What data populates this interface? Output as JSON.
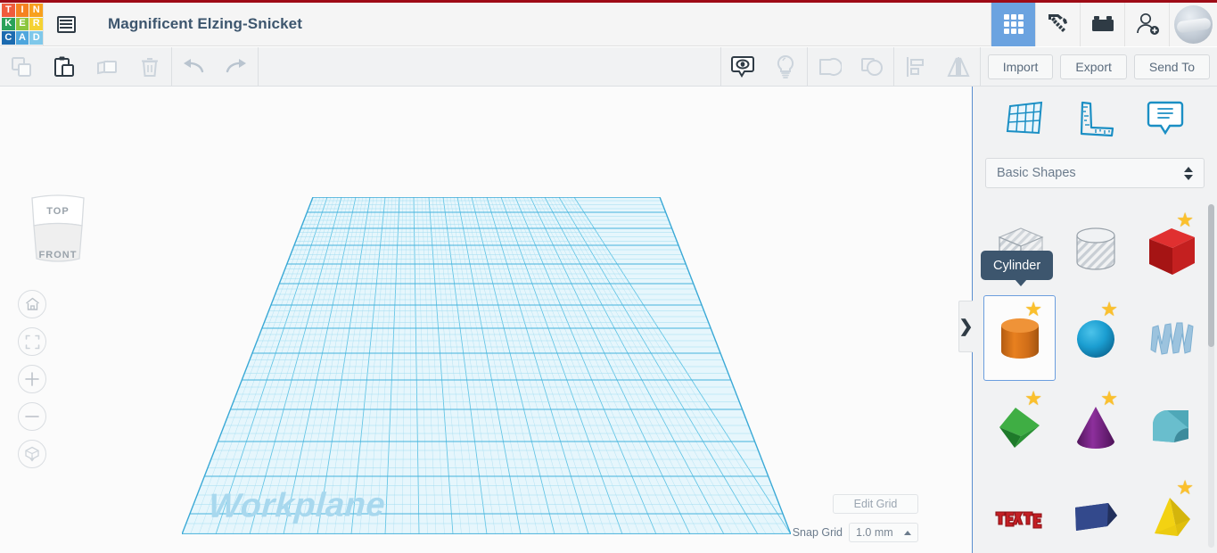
{
  "app": {
    "name": "Tinkercad",
    "accent_red": "#9e0b16",
    "accent_blue": "#1b8fc4",
    "selected_blue": "#6b9ede"
  },
  "logo": {
    "tiles": [
      {
        "letter": "T",
        "color": "#ef5b3c"
      },
      {
        "letter": "I",
        "color": "#f58220"
      },
      {
        "letter": "N",
        "color": "#f8a01c"
      },
      {
        "letter": "K",
        "color": "#2aa15a"
      },
      {
        "letter": "E",
        "color": "#8cc63e"
      },
      {
        "letter": "R",
        "color": "#f5d233"
      },
      {
        "letter": "C",
        "color": "#1c6bb0"
      },
      {
        "letter": "A",
        "color": "#4ea6dd"
      },
      {
        "letter": "D",
        "color": "#7fc8ea"
      }
    ]
  },
  "header": {
    "menu_icon": "list-menu-icon",
    "document_title": "Magnificent Elzing-Snicket",
    "right_icons": [
      {
        "name": "grid-apps-icon",
        "label": "Apps",
        "active": true
      },
      {
        "name": "pickaxe-icon",
        "label": "Minecraft",
        "active": false
      },
      {
        "name": "lego-brick-icon",
        "label": "Blocks",
        "active": false
      },
      {
        "name": "add-user-icon",
        "label": "Invite",
        "active": false
      }
    ],
    "avatar_label": "User avatar"
  },
  "toolbar": {
    "left_tools": [
      {
        "name": "copy-icon",
        "label": "Copy",
        "enabled": false
      },
      {
        "name": "paste-icon",
        "label": "Paste",
        "enabled": true
      },
      {
        "name": "duplicate-icon",
        "label": "Duplicate",
        "enabled": false
      },
      {
        "name": "delete-icon",
        "label": "Delete",
        "enabled": false
      }
    ],
    "history_tools": [
      {
        "name": "undo-icon",
        "label": "Undo",
        "enabled": false
      },
      {
        "name": "redo-icon",
        "label": "Redo",
        "enabled": false
      }
    ],
    "view_tools": [
      {
        "name": "show-hide-icon",
        "label": "Show/Hide",
        "enabled": true
      },
      {
        "name": "lightbulb-icon",
        "label": "Light",
        "enabled": false
      }
    ],
    "group_tools": [
      {
        "name": "group-icon",
        "label": "Group",
        "enabled": false
      },
      {
        "name": "ungroup-icon",
        "label": "Ungroup",
        "enabled": false
      }
    ],
    "align_tools": [
      {
        "name": "align-icon",
        "label": "Align",
        "enabled": false
      },
      {
        "name": "mirror-icon",
        "label": "Mirror",
        "enabled": false
      }
    ],
    "import_label": "Import",
    "export_label": "Export",
    "send_to_label": "Send To"
  },
  "viewport": {
    "view_cube": {
      "top_face": "TOP",
      "front_face": "FRONT"
    },
    "nav_buttons": [
      {
        "name": "home-view-icon",
        "label": "Home view"
      },
      {
        "name": "fit-to-view-icon",
        "label": "Fit all in view"
      },
      {
        "name": "zoom-in-icon",
        "label": "Zoom in"
      },
      {
        "name": "zoom-out-icon",
        "label": "Zoom out"
      },
      {
        "name": "ortho-perspective-icon",
        "label": "Switch to orthographic/perspective view"
      }
    ],
    "workplane_label": "Workplane",
    "grid_line_color": "#7fcce8",
    "grid_fill_color": "#d8f0fa",
    "edit_grid_label": "Edit Grid",
    "snap_grid_label": "Snap Grid",
    "snap_grid_value": "1.0 mm"
  },
  "panel": {
    "tools": [
      {
        "name": "workplane-icon",
        "label": "Workplane"
      },
      {
        "name": "ruler-icon",
        "label": "Ruler"
      },
      {
        "name": "note-icon",
        "label": "Note"
      }
    ],
    "collapse_chevron": "❯",
    "category_select": "Basic Shapes",
    "tooltip": "Cylinder",
    "shapes": [
      {
        "name": "box-hole",
        "label": "Box Hole",
        "starred": false,
        "selected": false
      },
      {
        "name": "cylinder-hole",
        "label": "Cylinder Hole",
        "starred": false,
        "selected": false
      },
      {
        "name": "box",
        "label": "Box",
        "starred": true,
        "selected": false
      },
      {
        "name": "cylinder",
        "label": "Cylinder",
        "starred": true,
        "selected": true
      },
      {
        "name": "sphere",
        "label": "Sphere",
        "starred": true,
        "selected": false
      },
      {
        "name": "scribble",
        "label": "Scribble",
        "starred": false,
        "selected": false
      },
      {
        "name": "pyramid-green",
        "label": "Pyramid",
        "starred": true,
        "selected": false
      },
      {
        "name": "cone",
        "label": "Cone",
        "starred": true,
        "selected": false
      },
      {
        "name": "roof",
        "label": "Roof",
        "starred": false,
        "selected": false
      },
      {
        "name": "text",
        "label": "Text",
        "starred": false,
        "selected": false
      },
      {
        "name": "wedge",
        "label": "Wedge",
        "starred": false,
        "selected": false
      },
      {
        "name": "pyramid-yellow",
        "label": "Pyramid",
        "starred": true,
        "selected": false
      }
    ]
  }
}
